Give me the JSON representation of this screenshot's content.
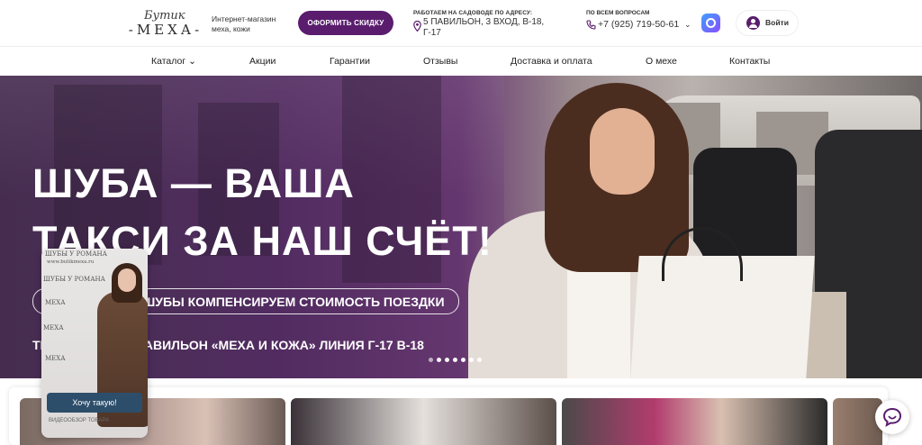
{
  "header": {
    "logo_script": "Бутик",
    "logo_name": "-МЕХА-",
    "tagline": "Интернет-магазин меха, кожи",
    "cta_label": "ОФОРМИТЬ СКИДКУ",
    "address_label": "РАБОТАЕМ НА САДОВОДЕ ПО АДРЕСУ:",
    "address": "5 ПАВИЛЬОН, 3 ВХОД, В-18, Г-17",
    "phone_label": "ПО ВСЕМ ВОПРОСАМ",
    "phone": "+7 (925) 719-50-61",
    "login_label": "Войти"
  },
  "nav": {
    "items": [
      {
        "label": "Каталог ⌄"
      },
      {
        "label": "Акции"
      },
      {
        "label": "Гарантии"
      },
      {
        "label": "Отзывы"
      },
      {
        "label": "Доставка и оплата"
      },
      {
        "label": "О мехе"
      },
      {
        "label": "Контакты"
      }
    ]
  },
  "hero": {
    "title_line1": "ШУБА — ВАША",
    "title_line2": "ТАКСИ ЗА НАШ СЧЁТ!",
    "promo": "ПРИ ПОКУПКЕ ШУБЫ КОМПЕНСИРУЕМ СТОИМОСТЬ ПОЕЗДКИ",
    "address": "ТЦ САДОВОД, 5 ПАВИЛЬОН «МЕХА И КОЖА» ЛИНИЯ Г-17 В-18",
    "slides_count": 7,
    "active_slide": 2
  },
  "story": {
    "watermark_top": "ШУБЫ У РОМАНА",
    "watermark_site": "www.butikmexa.ru",
    "watermark_brand": "МЕХА",
    "button_label": "Хочу такую!",
    "caption": "ВИДЕООБЗОР ТОВАРА"
  },
  "colors": {
    "brand": "#5a1d6e",
    "story_button": "#2d4e6b"
  }
}
